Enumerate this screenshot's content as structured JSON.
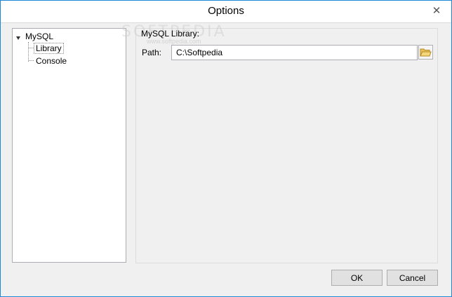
{
  "window": {
    "title": "Options"
  },
  "tree": {
    "root_label": "MySQL",
    "items": [
      {
        "label": "Library",
        "selected": true
      },
      {
        "label": "Console",
        "selected": false
      }
    ]
  },
  "panel": {
    "group_label": "MySQL Library:",
    "path_label": "Path:",
    "path_value": "C:\\Softpedia"
  },
  "buttons": {
    "ok": "OK",
    "cancel": "Cancel"
  },
  "icons": {
    "close": "close-icon",
    "browse": "folder-open-icon",
    "expander": "triangle-down-icon"
  },
  "colors": {
    "window_border": "#1e87d8",
    "background": "#f0f0f0"
  },
  "watermark": {
    "text": "SOFTPEDIA",
    "url": "www.softpedia.com"
  }
}
